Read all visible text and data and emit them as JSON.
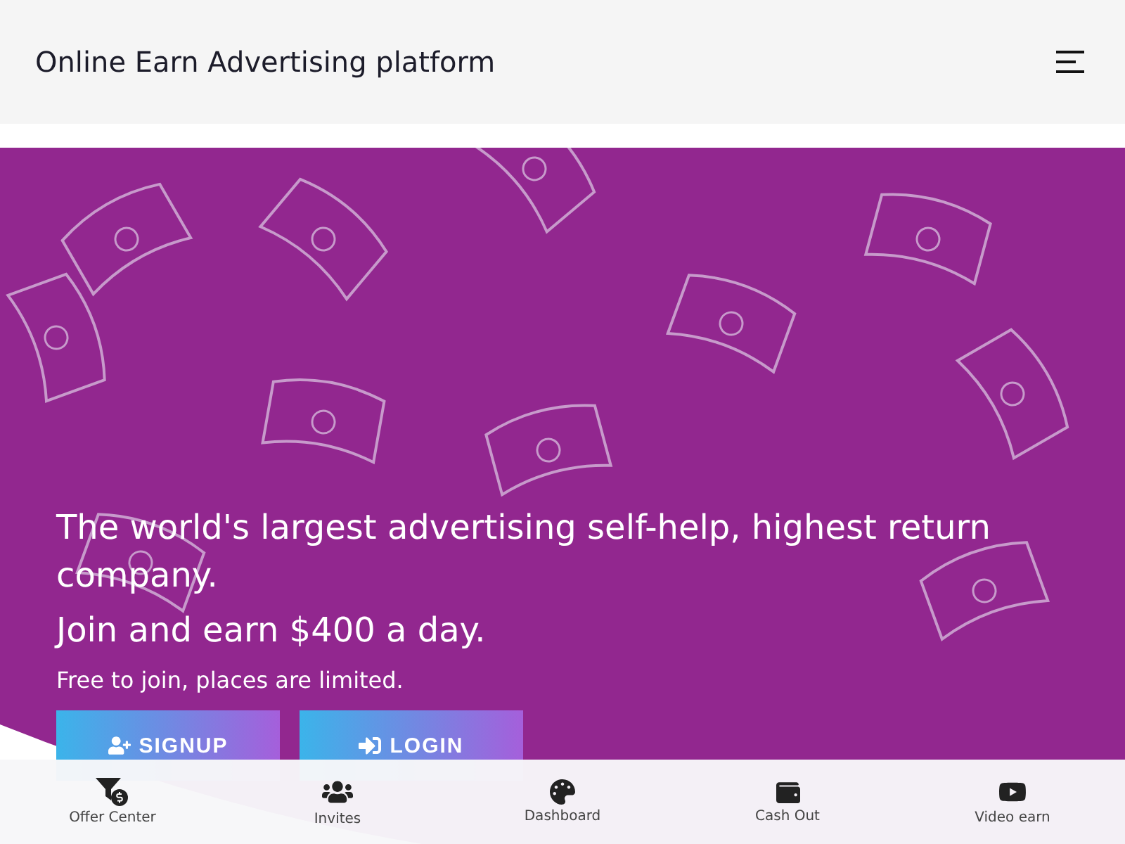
{
  "header": {
    "title": "Online Earn Advertising platform"
  },
  "hero": {
    "headline": "The world's largest advertising self-help, highest return company.",
    "subheadline": "Join and earn $400 a day.",
    "tagline": "Free to join, places are limited.",
    "buttons": [
      {
        "kind": "signup",
        "label": "SIGNUP"
      },
      {
        "kind": "login",
        "label": "LOGIN"
      }
    ]
  },
  "bottom_nav": [
    {
      "kind": "offers",
      "label": "Offer Center"
    },
    {
      "kind": "invites",
      "label": "Invites"
    },
    {
      "kind": "dashboard",
      "label": "Dashboard"
    },
    {
      "kind": "cashout",
      "label": "Cash Out"
    },
    {
      "kind": "video",
      "label": "Video earn"
    }
  ]
}
